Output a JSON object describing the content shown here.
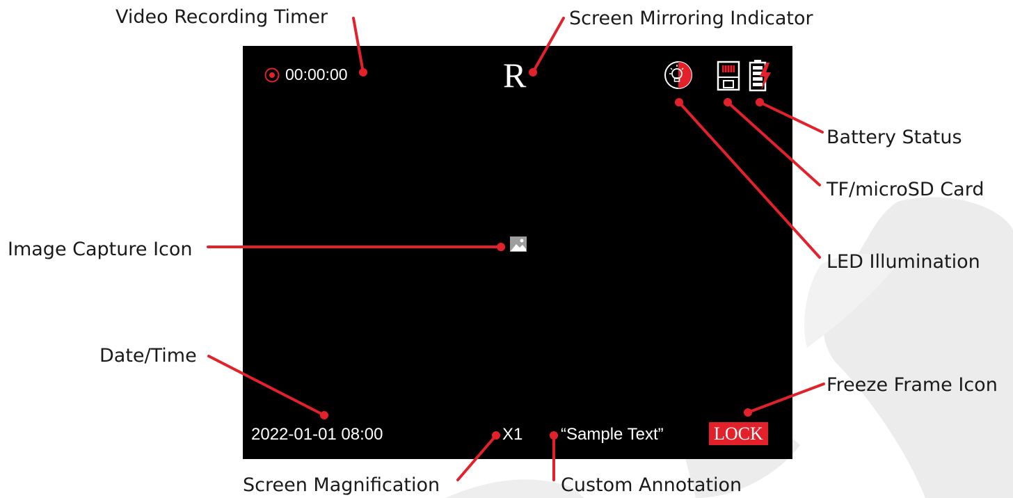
{
  "colors": {
    "accent": "#e3212b",
    "screen": "#000000",
    "osd_text": "#ffffff",
    "watermark": "#e6e6e6"
  },
  "osd": {
    "timer": "00:00:00",
    "mirror_letter": "R",
    "datetime": "2022-01-01 08:00",
    "magnification": "X1",
    "annotation": "“Sample Text”",
    "lock": "LOCK",
    "icons": [
      "record-dot-icon",
      "led-bulb-icon",
      "sd-card-icon",
      "battery-charging-icon",
      "image-capture-icon"
    ]
  },
  "callouts": {
    "video_timer": "Video Recording Timer",
    "mirroring": "Screen Mirroring Indicator",
    "battery": "Battery Status",
    "sd_card": "TF/microSD Card",
    "image_capture": "Image Capture Icon",
    "led": "LED Illumination",
    "datetime": "Date/Time",
    "freeze": "Freeze Frame Icon",
    "magnification": "Screen Magnification",
    "annotation": "Custom Annotation"
  }
}
